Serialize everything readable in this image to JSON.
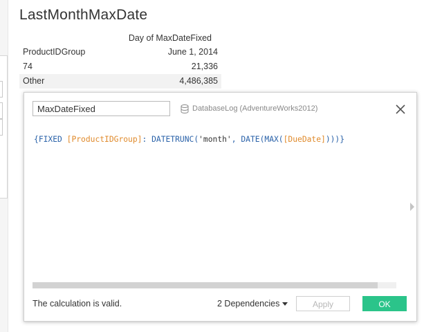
{
  "sheet": {
    "title": "LastMonthMaxDate"
  },
  "viz": {
    "column_header": "Day of MaxDateFixed",
    "row_header_label": "ProductIDGroup",
    "row_header_value": "June 1, 2014",
    "rows": [
      {
        "group": "74",
        "value": "21,336"
      },
      {
        "group": "Other",
        "value": "4,486,385"
      }
    ]
  },
  "calc_dialog": {
    "name_value": "MaxDateFixed",
    "datasource_icon": "database-icon",
    "datasource_label": "DatabaseLog (AdventureWorks2012)",
    "close_icon": "close-icon",
    "formula": {
      "open_brace": "{",
      "keyword_fixed": "FIXED",
      "field_product_group": "[ProductIDGroup]",
      "colon": ":",
      "fn_datetrunc": "DATETRUNC",
      "open_paren": "(",
      "arg_month": "'month'",
      "comma": ",",
      "fn_date": "DATE",
      "fn_max": "MAX",
      "field_due_date": "[DueDate]",
      "close_parens_brace": ")))}"
    },
    "status_text": "The calculation is valid.",
    "dependencies_label": "2 Dependencies",
    "apply_label": "Apply",
    "ok_label": "OK",
    "colors": {
      "ok": "#2bc48a",
      "field": "#e08a2b",
      "function": "#2a62a9"
    }
  }
}
